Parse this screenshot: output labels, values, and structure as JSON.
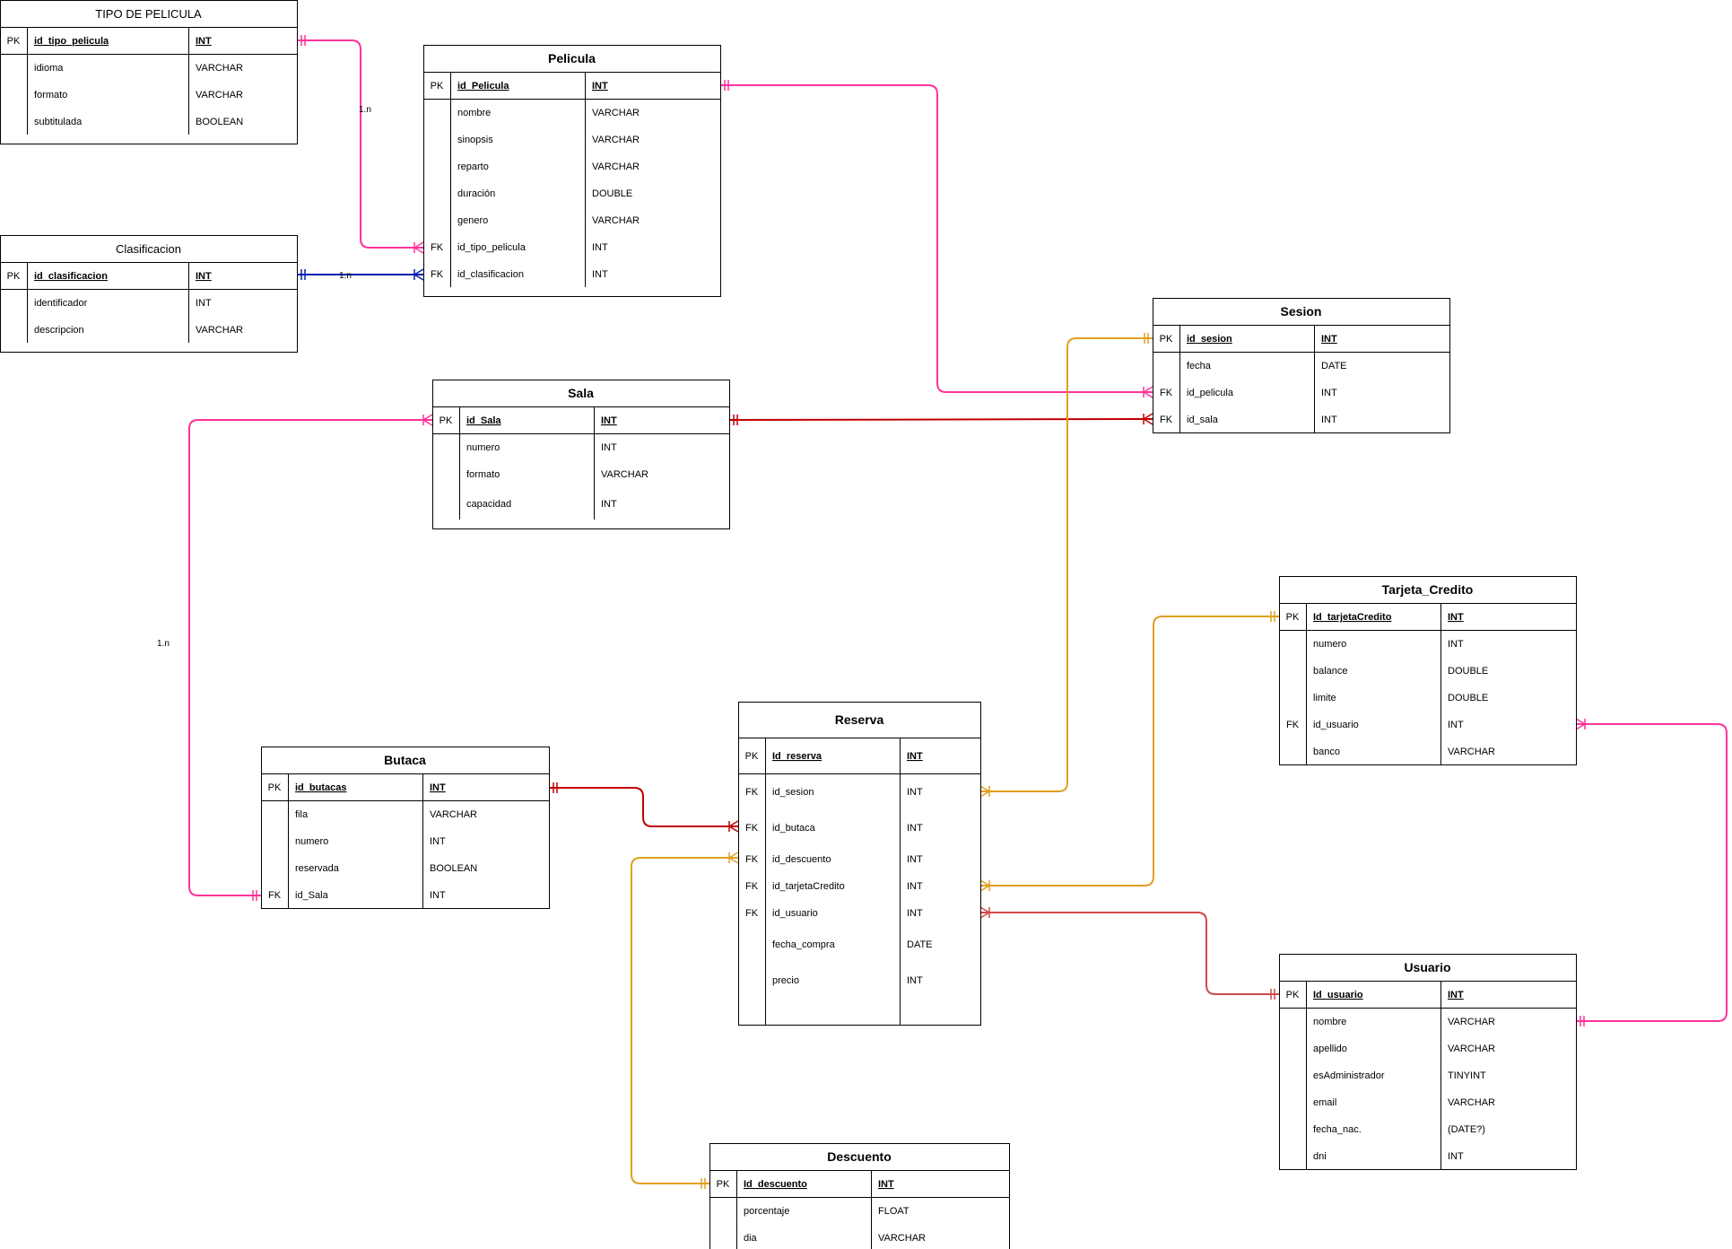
{
  "colors": {
    "pink": "#ff3399",
    "blue": "#0020b0",
    "red": "#c00000",
    "orange": "#e0a020",
    "salmon": "#d04a4a",
    "border": "#000000"
  },
  "tables": [
    {
      "id": "tipo",
      "title": "TIPO DE PELICULA",
      "bold": false,
      "pk": {
        "key": "PK",
        "name": "id_tipo_pelicula",
        "type": "INT"
      },
      "rows": [
        {
          "key": "",
          "name": "idioma",
          "type": "VARCHAR"
        },
        {
          "key": "",
          "name": "formato",
          "type": "VARCHAR"
        },
        {
          "key": "",
          "name": "subtitulada",
          "type": "BOOLEAN"
        }
      ]
    },
    {
      "id": "clasif",
      "title": "Clasificacion",
      "bold": false,
      "pk": {
        "key": "PK",
        "name": "id_clasificacion",
        "type": "INT"
      },
      "rows": [
        {
          "key": "",
          "name": "identificador",
          "type": "INT"
        },
        {
          "key": "",
          "name": "descripcion",
          "type": "VARCHAR"
        }
      ]
    },
    {
      "id": "pelicula",
      "title": "Pelicula",
      "bold": true,
      "pk": {
        "key": "PK",
        "name": "id_Pelicula",
        "type": "INT"
      },
      "rows": [
        {
          "key": "",
          "name": "nombre",
          "type": "VARCHAR"
        },
        {
          "key": "",
          "name": "sinopsis",
          "type": "VARCHAR"
        },
        {
          "key": "",
          "name": "reparto",
          "type": "VARCHAR"
        },
        {
          "key": "",
          "name": "duración",
          "type": "DOUBLE"
        },
        {
          "key": "",
          "name": "genero",
          "type": "VARCHAR"
        },
        {
          "key": "FK",
          "name": "id_tipo_pelicula",
          "type": "INT"
        },
        {
          "key": "FK",
          "name": "id_clasificacion",
          "type": "INT"
        }
      ]
    },
    {
      "id": "sala",
      "title": "Sala",
      "bold": true,
      "pk": {
        "key": "PK",
        "name": "id_Sala",
        "type": "INT"
      },
      "rows": [
        {
          "key": "",
          "name": "numero",
          "type": "INT"
        },
        {
          "key": "",
          "name": "formato",
          "type": "VARCHAR"
        },
        {
          "key": "",
          "name": "capacidad",
          "type": "INT"
        }
      ]
    },
    {
      "id": "sesion",
      "title": "Sesion",
      "bold": true,
      "pk": {
        "key": "PK",
        "name": "id_sesion",
        "type": "INT"
      },
      "rows": [
        {
          "key": "",
          "name": "fecha",
          "type": "DATE"
        },
        {
          "key": "FK",
          "name": "id_pelicula",
          "type": "INT"
        },
        {
          "key": "FK",
          "name": "id_sala",
          "type": "INT"
        }
      ]
    },
    {
      "id": "tarjeta",
      "title": "Tarjeta_Credito",
      "bold": true,
      "pk": {
        "key": "PK",
        "name": "Id_tarjetaCredito",
        "type": "INT"
      },
      "rows": [
        {
          "key": "",
          "name": "numero",
          "type": "INT"
        },
        {
          "key": "",
          "name": "balance",
          "type": "DOUBLE"
        },
        {
          "key": "",
          "name": "limite",
          "type": "DOUBLE"
        },
        {
          "key": "FK",
          "name": "id_usuario",
          "type": "INT"
        },
        {
          "key": "",
          "name": "banco",
          "type": "VARCHAR"
        }
      ]
    },
    {
      "id": "reserva",
      "title": "Reserva",
      "bold": true,
      "pk": {
        "key": "PK",
        "name": "Id_reserva",
        "type": "INT"
      },
      "rows": [
        {
          "key": "FK",
          "name": "id_sesion",
          "type": "INT"
        },
        {
          "key": "FK",
          "name": "id_butaca",
          "type": "INT"
        },
        {
          "key": "FK",
          "name": "id_descuento",
          "type": "INT"
        },
        {
          "key": "FK",
          "name": "id_tarjetaCredito",
          "type": "INT"
        },
        {
          "key": "FK",
          "name": "id_usuario",
          "type": "INT"
        },
        {
          "key": "",
          "name": "fecha_compra",
          "type": "DATE"
        },
        {
          "key": "",
          "name": "precio",
          "type": "INT"
        }
      ]
    },
    {
      "id": "butaca",
      "title": "Butaca",
      "bold": true,
      "pk": {
        "key": "PK",
        "name": "id_butacas",
        "type": "INT"
      },
      "rows": [
        {
          "key": "",
          "name": "fila",
          "type": "VARCHAR"
        },
        {
          "key": "",
          "name": "numero",
          "type": "INT"
        },
        {
          "key": "",
          "name": "reservada",
          "type": "BOOLEAN"
        },
        {
          "key": "FK",
          "name": "id_Sala",
          "type": "INT"
        }
      ]
    },
    {
      "id": "usuario",
      "title": "Usuario",
      "bold": true,
      "pk": {
        "key": "PK",
        "name": "Id_usuario",
        "type": "INT"
      },
      "rows": [
        {
          "key": "",
          "name": "nombre",
          "type": "VARCHAR"
        },
        {
          "key": "",
          "name": "apellido",
          "type": "VARCHAR"
        },
        {
          "key": "",
          "name": "esAdministrador",
          "type": "TINYINT"
        },
        {
          "key": "",
          "name": "email",
          "type": "VARCHAR"
        },
        {
          "key": "",
          "name": "fecha_nac.",
          "type": "(DATE?)"
        },
        {
          "key": "",
          "name": "dni",
          "type": "INT"
        }
      ]
    },
    {
      "id": "descuento",
      "title": "Descuento",
      "bold": true,
      "pk": {
        "key": "PK",
        "name": "Id_descuento",
        "type": "INT"
      },
      "rows": [
        {
          "key": "",
          "name": "porcentaje",
          "type": "FLOAT"
        },
        {
          "key": "",
          "name": "dia",
          "type": "VARCHAR"
        }
      ]
    }
  ],
  "relations": [
    {
      "id": "tipo-pelicula",
      "color": "pink",
      "label": "1.n"
    },
    {
      "id": "clasif-pelicula",
      "color": "blue",
      "label": "1.n"
    },
    {
      "id": "pelicula-sesion",
      "color": "pink",
      "label": ""
    },
    {
      "id": "sala-sesion",
      "color": "red",
      "label": ""
    },
    {
      "id": "sala-butaca",
      "color": "pink",
      "label": "1.n"
    },
    {
      "id": "sesion-reserva",
      "color": "orange",
      "label": ""
    },
    {
      "id": "butaca-reserva",
      "color": "red",
      "label": ""
    },
    {
      "id": "descuento-reserva",
      "color": "orange",
      "label": ""
    },
    {
      "id": "tarjeta-reserva",
      "color": "orange",
      "label": ""
    },
    {
      "id": "usuario-reserva",
      "color": "salmon",
      "label": ""
    },
    {
      "id": "usuario-tarjeta",
      "color": "pink",
      "label": ""
    }
  ]
}
